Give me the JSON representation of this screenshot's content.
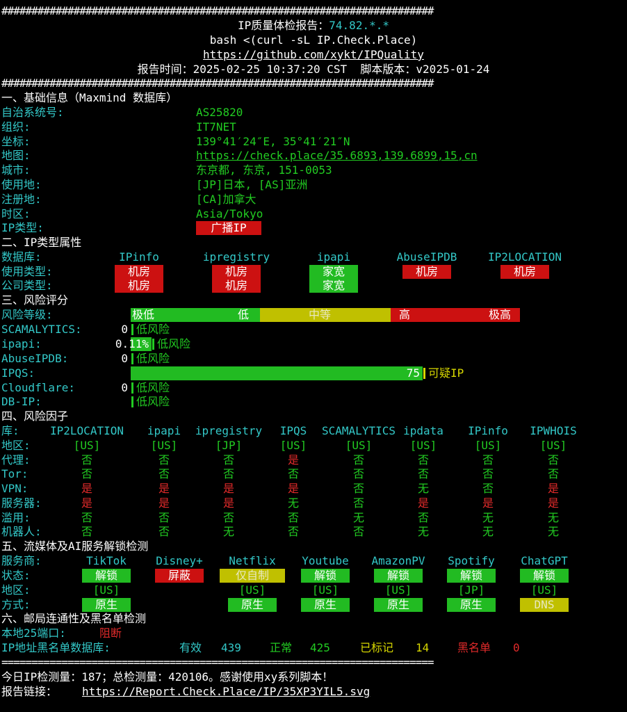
{
  "header": {
    "hash_line": "########################################################################",
    "title_prefix": "IP质量体检报告：",
    "title_ip": "74.82.*.*",
    "command": "bash <(curl -sL IP.Check.Place)",
    "repo": "https://github.com/xykt/IPQuality",
    "report_time": "报告时间：2025-02-25 10:37:20 CST  脚本版本：v2025-01-24"
  },
  "basic": {
    "heading": "一、基础信息（Maxmind 数据库）",
    "rows": [
      {
        "label": "自治系统号:",
        "value": "AS25820"
      },
      {
        "label": "组织:",
        "value": "IT7NET"
      },
      {
        "label": "坐标:",
        "value": "139°41′24″E, 35°41′21″N"
      },
      {
        "label": "地图:",
        "value": "https://check.place/35.6893,139.6899,15,cn"
      },
      {
        "label": "城市:",
        "value": "东京都, 东京, 151-0053"
      },
      {
        "label": "使用地:",
        "value": "[JP]日本, [AS]亚洲"
      },
      {
        "label": "注册地:",
        "value": "[CA]加拿大"
      },
      {
        "label": "时区:",
        "value": "Asia/Tokyo"
      }
    ],
    "iptype_label": "IP类型:",
    "iptype_value": "广播IP"
  },
  "iptype": {
    "heading": "二、IP类型属性",
    "db_label": "数据库:",
    "dbs": [
      "IPinfo",
      "ipregistry",
      "ipapi",
      "AbuseIPDB",
      "IP2LOCATION"
    ],
    "usage_label": "使用类型:",
    "usage": [
      "机房",
      "机房",
      "家宽",
      "机房",
      "机房"
    ],
    "company_label": "公司类型:",
    "company": [
      "机房",
      "机房",
      "家宽"
    ]
  },
  "risk": {
    "heading": "三、风险评分",
    "level_label": "风险等级:",
    "levels": [
      "极低",
      "低",
      "中等",
      "高",
      "极高"
    ],
    "rows": [
      {
        "label": "SCAMALYTICS:",
        "score": "0",
        "text": "低风险",
        "pct": 0
      },
      {
        "label": "ipapi:",
        "score": "0.11%",
        "text": "低风险",
        "pct": 5
      },
      {
        "label": "AbuseIPDB:",
        "score": "0",
        "text": "低风险",
        "pct": 0
      },
      {
        "label": "IPQS:",
        "score": "75",
        "text": "可疑IP",
        "pct": 75
      },
      {
        "label": "Cloudflare:",
        "score": "0",
        "text": "低风险",
        "pct": 0
      },
      {
        "label": "DB-IP:",
        "score": "",
        "text": "低风险",
        "pct": 0
      }
    ]
  },
  "factors": {
    "heading": "四、风险因子",
    "lib_label": "库:",
    "libs": [
      "IP2LOCATION",
      "ipapi",
      "ipregistry",
      "IPQS",
      "SCAMALYTICS",
      "ipdata",
      "IPinfo",
      "IPWHOIS"
    ],
    "rows": [
      {
        "label": "地区:",
        "vals": [
          "[US]",
          "[US]",
          "[JP]",
          "[US]",
          "[US]",
          "[US]",
          "[US]",
          "[US]"
        ]
      },
      {
        "label": "代理:",
        "vals": [
          "否",
          "否",
          "否",
          "是",
          "否",
          "否",
          "否",
          "否"
        ]
      },
      {
        "label": "Tor:",
        "vals": [
          "否",
          "否",
          "否",
          "否",
          "否",
          "否",
          "否",
          "否"
        ]
      },
      {
        "label": "VPN:",
        "vals": [
          "是",
          "是",
          "是",
          "是",
          "否",
          "无",
          "否",
          "是"
        ]
      },
      {
        "label": "服务器:",
        "vals": [
          "是",
          "是",
          "是",
          "无",
          "否",
          "是",
          "是",
          "是"
        ]
      },
      {
        "label": "滥用:",
        "vals": [
          "否",
          "否",
          "否",
          "否",
          "无",
          "否",
          "无",
          "无"
        ]
      },
      {
        "label": "机器人:",
        "vals": [
          "否",
          "否",
          "无",
          "否",
          "否",
          "无",
          "无",
          "无"
        ]
      }
    ]
  },
  "streaming": {
    "heading": "五、流媒体及AI服务解锁检测",
    "provider_label": "服务商:",
    "providers": [
      "TikTok",
      "Disney+",
      "Netflix",
      "Youtube",
      "AmazonPV",
      "Spotify",
      "ChatGPT"
    ],
    "status_label": "状态:",
    "status": [
      "解锁",
      "屏蔽",
      "仅自制",
      "解锁",
      "解锁",
      "解锁",
      "解锁"
    ],
    "region_label": "地区:",
    "regions": [
      "[US]",
      "",
      "[US]",
      "[US]",
      "[US]",
      "[JP]",
      "[US]"
    ],
    "method_label": "方式:",
    "methods": [
      "原生",
      "",
      "原生",
      "原生",
      "原生",
      "原生",
      "DNS"
    ]
  },
  "mail": {
    "heading": "六、邮局连通性及黑名单检测",
    "port_label": "本地25端口:",
    "port_value": "阻断",
    "bl_label": "IP地址黑名单数据库:",
    "valid_label": "有效",
    "valid": "439",
    "normal_label": "正常",
    "normal": "425",
    "marked_label": "已标记",
    "marked": "14",
    "black_label": "黑名单",
    "black": "0"
  },
  "footer": {
    "eq_line": "========================================================================",
    "stats": "今日IP检测量：187；总检测量：420106。感谢使用xy系列脚本！",
    "link_label": "报告链接：",
    "link": "https://Report.Check.Place/IP/35XP3YIL5.svg"
  }
}
